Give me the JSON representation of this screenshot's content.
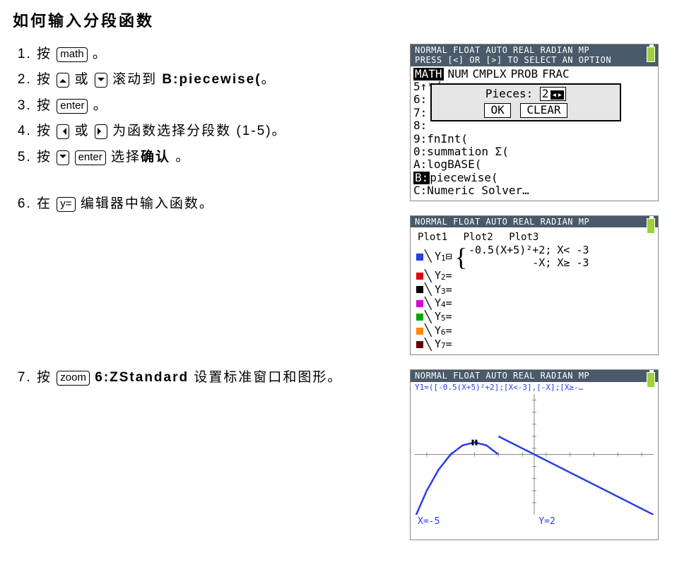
{
  "title": "如何输入分段函数",
  "steps": {
    "s1_a": "按 ",
    "s1_key": "math",
    "s1_b": " 。",
    "s2_a": "按 ",
    "s2_b": " 或 ",
    "s2_c": " 滚动到 ",
    "s2_bold": "B:piecewise(",
    "s2_d": "。",
    "s3_a": "按 ",
    "s3_key": "enter",
    "s3_b": " 。",
    "s4_a": "按 ",
    "s4_b": " 或 ",
    "s4_c": " 为函数选择分段数 (1-5)。",
    "s5_a": "按 ",
    "s5_key": "enter",
    "s5_b": " 选择",
    "s5_bold": "确认",
    "s5_c": " 。",
    "s6_a": "在 ",
    "s6_key": "y=",
    "s6_b": " 编辑器中输入函数。",
    "s7_a": "按 ",
    "s7_key": "zoom",
    "s7_b": " ",
    "s7_bold": "6:ZStandard",
    "s7_c": " 设置标准窗口和图形。"
  },
  "screen1": {
    "header_l1": "NORMAL FLOAT AUTO REAL RADIAN MP",
    "header_l2": "PRESS [<] OR [>] TO SELECT AN OPTION",
    "tab_math": "MATH",
    "tab_num": "NUM",
    "tab_cmplx": "CMPLX",
    "tab_prob": "PROB",
    "tab_frac": "FRAC",
    "row5": "5↑ˣ√",
    "row6": "6:",
    "row7": "7:",
    "row8": "8:",
    "dialog_label": "Pieces:",
    "dialog_value": "2",
    "btn_ok": "OK",
    "btn_clear": "CLEAR",
    "row9": "9:fnInt(",
    "row0": "0:summation Σ(",
    "rowA": "A:logBASE(",
    "rowB_prefix": "B:",
    "rowB_text": "piecewise(",
    "rowC": "C:Numeric Solver…"
  },
  "screen2": {
    "header": "NORMAL FLOAT AUTO REAL RADIAN MP",
    "plot1": "Plot1",
    "plot2": "Plot2",
    "plot3": "Plot3",
    "y1_label": "\\Y₁⊟",
    "pw": {
      "e1": "-0.5(X+5)²+2;",
      "c1": "X< -3",
      "e2": "-X;",
      "c2": "X≥ -3"
    },
    "y2": "\\Y₂=",
    "y3": "\\Y₃=",
    "y4": "\\Y₄=",
    "y5": "\\Y₅=",
    "y6": "\\Y₆=",
    "y7": "\\Y₇="
  },
  "screen3": {
    "header": "NORMAL FLOAT AUTO REAL RADIAN MP",
    "fn_line": "Y1=([-0.5(X+5)²+2];[X<-3],[-X];[X≥-…",
    "x_coord": "X=-5",
    "y_coord": "Y=2"
  },
  "chart_data": {
    "type": "line",
    "title": "",
    "xlabel": "",
    "ylabel": "",
    "xlim": [
      -10,
      10
    ],
    "ylim": [
      -10,
      10
    ],
    "series": [
      {
        "name": "y = -0.5(x+5)^2 + 2  (x < -3)",
        "x": [
          -10,
          -9,
          -8,
          -7,
          -6,
          -5,
          -4,
          -3.01
        ],
        "y": [
          -10.5,
          -6,
          -2.5,
          0,
          1.5,
          2,
          1.5,
          0.02
        ]
      },
      {
        "name": "y = -x  (x ≥ -3)",
        "x": [
          -3,
          -2,
          0,
          2,
          4,
          6,
          8,
          10
        ],
        "y": [
          3,
          2,
          0,
          -2,
          -4,
          -6,
          -8,
          -10
        ]
      }
    ],
    "marker": {
      "x": -5,
      "y": 2
    }
  }
}
